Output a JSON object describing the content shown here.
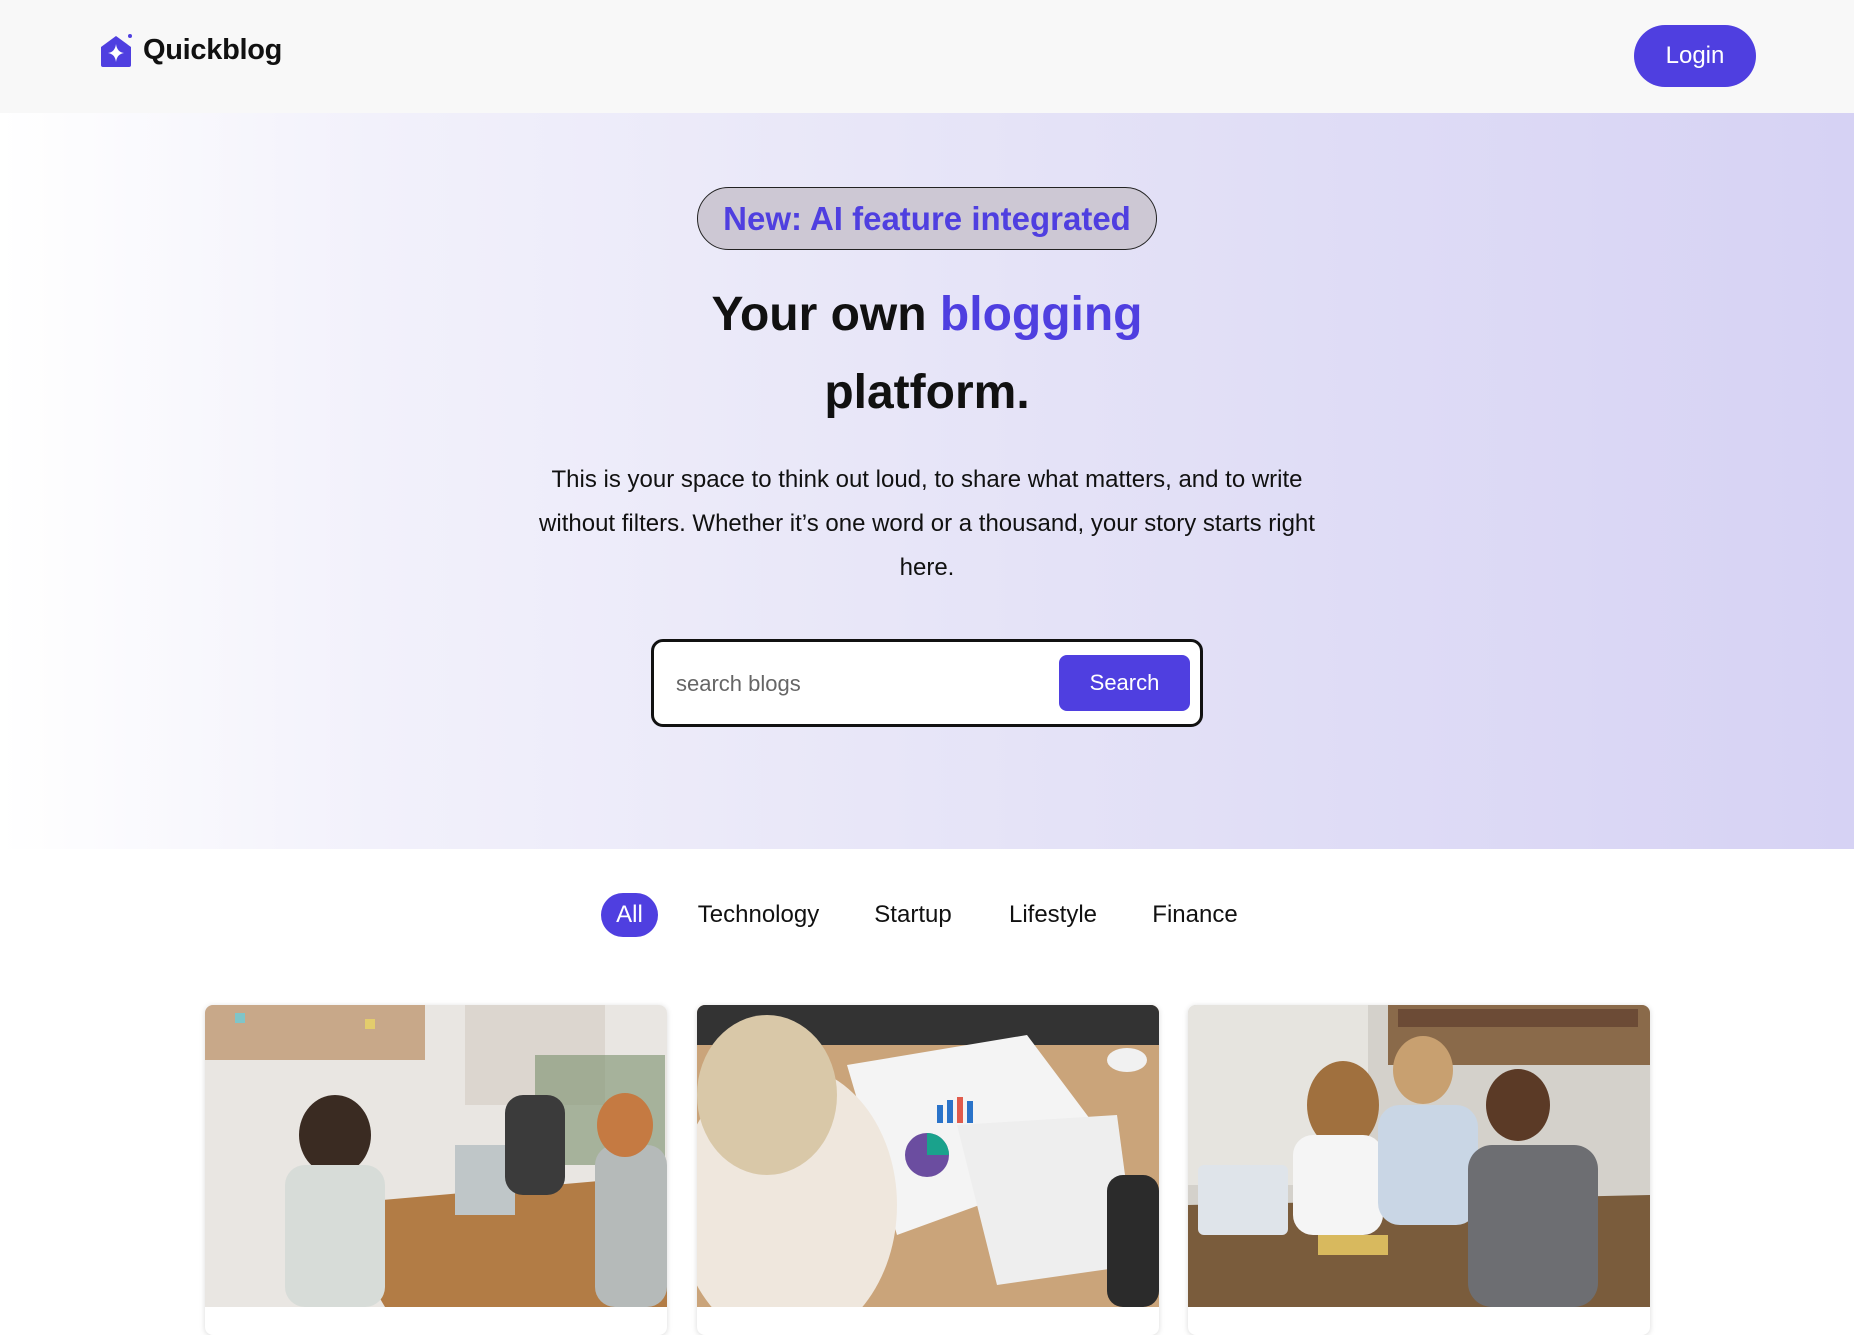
{
  "header": {
    "logo_text": "Quickblog",
    "login_label": "Login"
  },
  "hero": {
    "badge": "New: AI feature integrated",
    "headline_start": "Your own ",
    "headline_accent": "blogging",
    "headline_end": "platform.",
    "subtext": "This is your space to think out loud, to share what matters, and to write without filters. Whether it’s one word or a thousand, your story starts right here.",
    "search": {
      "placeholder": "search blogs",
      "button_label": "Search"
    }
  },
  "categories": {
    "items": [
      {
        "label": "All",
        "active": true
      },
      {
        "label": "Technology",
        "active": false
      },
      {
        "label": "Startup",
        "active": false
      },
      {
        "label": "Lifestyle",
        "active": false
      },
      {
        "label": "Finance",
        "active": false
      }
    ]
  },
  "cards": [
    {
      "image": "office-meeting-photo"
    },
    {
      "image": "financial-charts-photo"
    },
    {
      "image": "students-studying-photo"
    }
  ],
  "colors": {
    "accent": "#4f3fe0",
    "header_bg": "#f8f8f8",
    "badge_bg": "#cdc8d4"
  }
}
